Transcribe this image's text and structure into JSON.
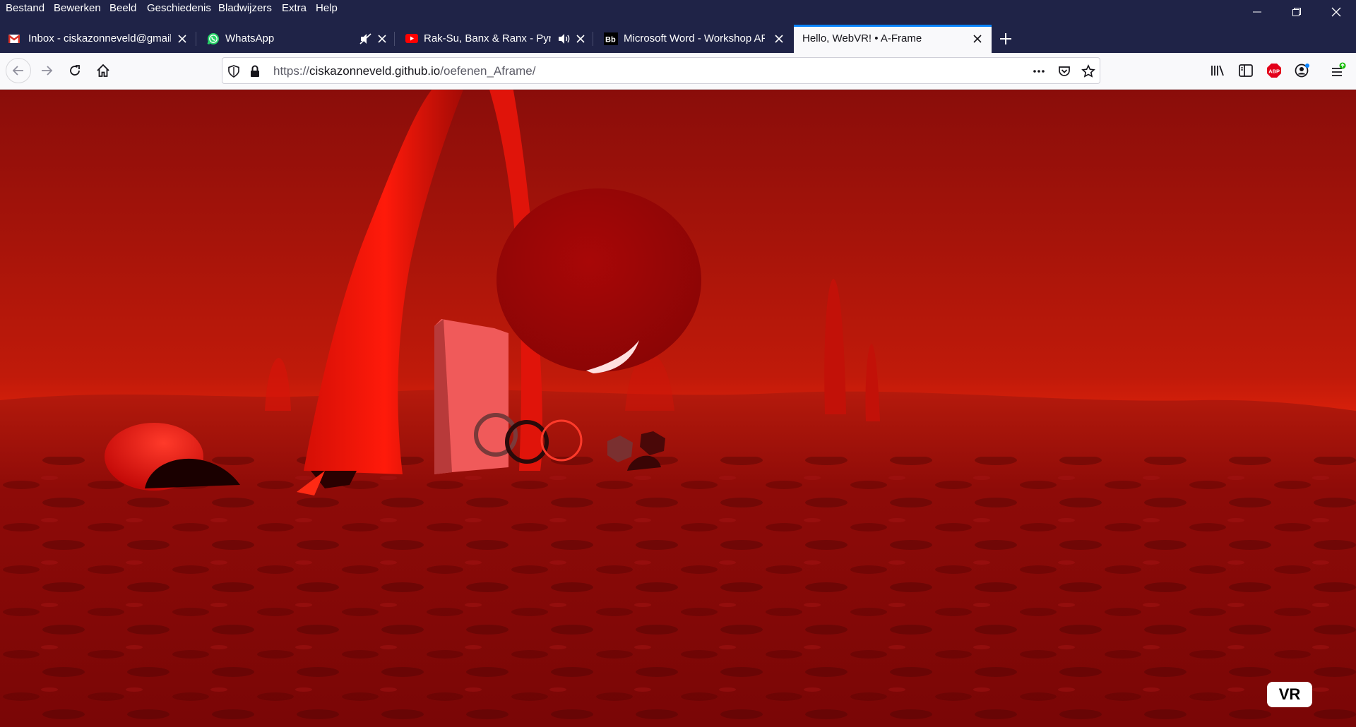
{
  "menubar": {
    "items": [
      "Bestand",
      "Bewerken",
      "Beeld",
      "Geschiedenis",
      "Bladwijzers",
      "Extra",
      "Help"
    ]
  },
  "tabs": [
    {
      "title": "Inbox - ciskazonneveld@gmail",
      "icon": "gmail-icon",
      "active": false
    },
    {
      "title": "WhatsApp",
      "icon": "whatsapp-icon",
      "active": false,
      "muted_indicator": "speaker-muted-icon"
    },
    {
      "title": "Rak-Su, Banx & Ranx - Pyro",
      "icon": "youtube-icon",
      "active": false,
      "audio_indicator": "speaker-playing-icon"
    },
    {
      "title": "Microsoft Word - Workshop AF",
      "icon": "blackboard-icon",
      "active": false
    },
    {
      "title": "Hello, WebVR! • A-Frame",
      "icon": "none",
      "active": true
    }
  ],
  "navbar": {
    "url_prefix": "https://",
    "url_host": "ciskazonneveld.github.io",
    "url_path": "/oefenen_Aframe/"
  },
  "scene": {
    "vr_button_label": "VR"
  },
  "colors": {
    "chrome_dark": "#1f2347",
    "active_tab_accent": "#0a84ff",
    "sky_red": "#b81400",
    "ground_red": "#8a0a0a"
  }
}
